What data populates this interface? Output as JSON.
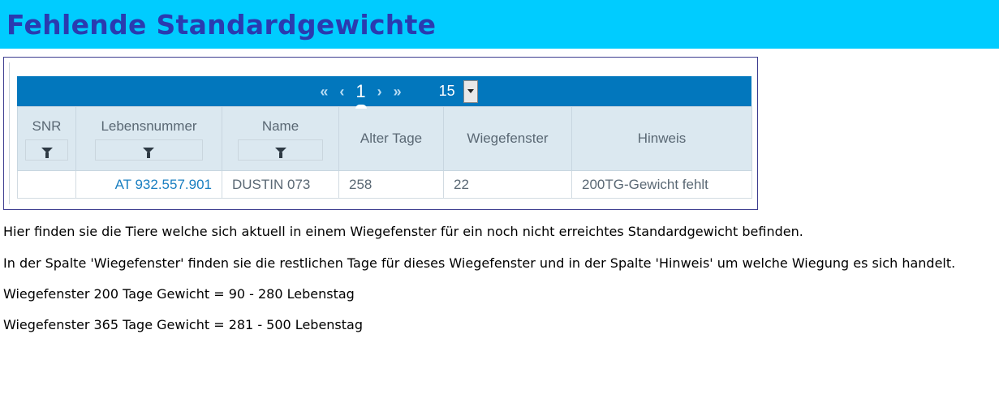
{
  "page": {
    "title": "Fehlende Standardgewichte"
  },
  "pager": {
    "first": "«",
    "prev": "‹",
    "current_page": "1",
    "next": "›",
    "last": "»",
    "page_size": "15"
  },
  "table": {
    "columns": [
      "SNR",
      "Lebensnummer",
      "Name",
      "Alter Tage",
      "Wiegefenster",
      "Hinweis"
    ],
    "rows": [
      {
        "snr": "",
        "lebensnummer": "AT 932.557.901",
        "name": "DUSTIN 073",
        "alter_tage": "258",
        "wiegefenster": "22",
        "hinweis": "200TG-Gewicht fehlt"
      }
    ]
  },
  "info": {
    "line1": "Hier finden sie die Tiere welche sich aktuell in einem Wiegefenster für ein noch nicht erreichtes Standardgewicht befinden.",
    "line2": "In der Spalte 'Wiegefenster' finden sie die restlichen Tage für dieses Wiegefenster und in der Spalte 'Hinweis' um welche Wiegung es sich handelt.",
    "line3": "Wiegefenster 200 Tage Gewicht = 90 - 280 Lebenstag",
    "line4": "Wiegefenster 365 Tage Gewicht = 281 - 500 Lebenstag"
  },
  "colors": {
    "header_bg": "#00ccff",
    "title": "#2a3bb0",
    "pager_bg": "#0277bd",
    "link": "#1a7fc1"
  }
}
